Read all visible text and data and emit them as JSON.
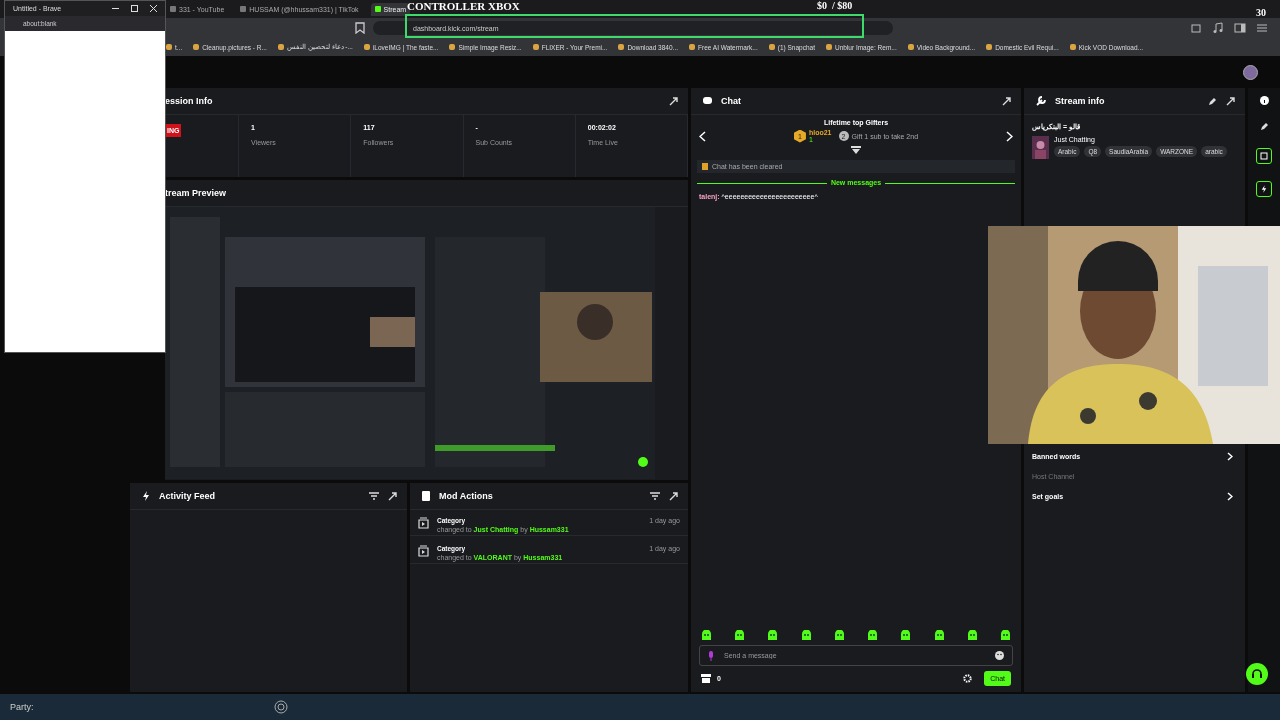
{
  "browser": {
    "tabs": [
      {
        "label": "331 - YouTube",
        "selected": false
      },
      {
        "label": "HUSSAM (@hhussam331) | TikTok",
        "selected": false
      },
      {
        "label": "Stream",
        "selected": true
      }
    ],
    "address": "dashboard.kick.com/stream",
    "bookmarks": [
      "t...",
      "Cleanup.pictures - R...",
      "دعاء لتحصين النفس -...",
      "iLoveIMG | The faste...",
      "Simple Image Resiz...",
      "FLIXER - Your Premi...",
      "Download 3840...",
      "Free AI Watermark...",
      "(1) Snapchat",
      "Unblur Image: Rem...",
      "Video Background...",
      "Domestic Evil Requi...",
      "Kick VOD Download..."
    ]
  },
  "popup_window": {
    "title": "Untitled - Brave",
    "address": "about:blank"
  },
  "overlay": {
    "title": "CONTROLLER XBOX",
    "goal": "$0  / $80",
    "counter": "30"
  },
  "session_info": {
    "title": "ession Info",
    "badge": "ING",
    "stats": [
      {
        "value": "1",
        "label": "Viewers"
      },
      {
        "value": "117",
        "label": "Followers"
      },
      {
        "value": "-",
        "label": "Sub Counts"
      },
      {
        "value": "00:02:02",
        "label": "Time Live"
      }
    ]
  },
  "stream_preview": {
    "title": "tream Preview"
  },
  "activity_feed": {
    "title": "Activity Feed"
  },
  "mod_actions": {
    "title": "Mod Actions",
    "items": [
      {
        "title": "Category",
        "prefix": "changed to",
        "value": "Just Chatting",
        "by": "by",
        "user": "Hussam331",
        "time": "1 day ago"
      },
      {
        "title": "Category",
        "prefix": "changed to",
        "value": "VALORANT",
        "by": "by",
        "user": "Hussam331",
        "time": "1 day ago"
      }
    ]
  },
  "chat": {
    "title": "Chat",
    "gifters_title": "Lifetime top Gifters",
    "gifter": {
      "rank": "1",
      "name": "hloo21",
      "count": "1"
    },
    "gift_hint_rank": "2",
    "gift_hint": "Gift 1 sub to take 2nd",
    "cleared": "Chat has been cleared",
    "new_messages": "New messages",
    "messages": [
      {
        "user": "talenj:",
        "text": "^eeeeeeeeeeeeeeeeeeeeeee^"
      }
    ],
    "input": {
      "placeholder": "Send a message"
    },
    "points": "0",
    "send": "Chat"
  },
  "stream_info": {
    "title": "قالو = البنكرياس",
    "category": "Just Chatting",
    "tags": [
      "Arabic",
      "Q8",
      "SaudiaArabia",
      "WARZONE",
      "arabic"
    ],
    "section_title": "Stream info",
    "links": [
      {
        "label": "Banned words",
        "disabled": false
      },
      {
        "label": "Host Channel",
        "disabled": true
      },
      {
        "label": "Set goals",
        "disabled": false
      }
    ]
  },
  "taskbar": {
    "party": "Party:"
  }
}
